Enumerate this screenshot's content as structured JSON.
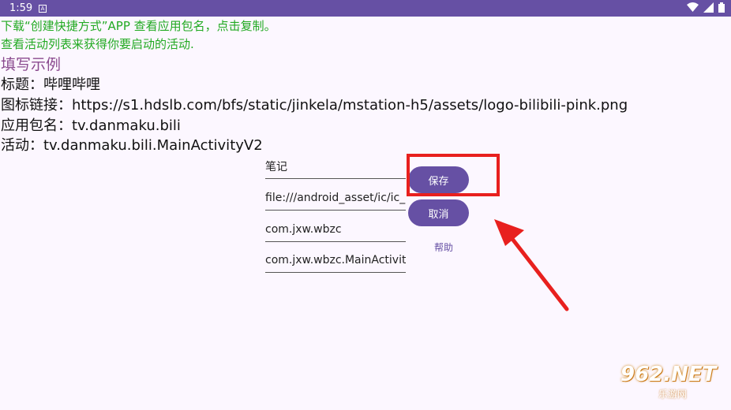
{
  "status_bar": {
    "time": "1:59",
    "notification_icon": "a-box-icon"
  },
  "instructions": {
    "line1": "下载“创建快捷方式”APP 查看应用包名，点击复制。",
    "line2": "查看活动列表来获得你要启动的活动."
  },
  "example": {
    "heading": "填写示例",
    "title_line": "标题：哔哩哔哩",
    "icon_line": "图标链接：https://s1.hdslb.com/bfs/static/jinkela/mstation-h5/assets/logo-bilibili-pink.png",
    "package_line": "应用包名：tv.danmaku.bili",
    "activity_line": "活动：tv.danmaku.bili.MainActivityV2"
  },
  "form": {
    "title_value": "笔记",
    "icon_value": "file:///android_asset/ic/ic_",
    "package_value": "com.jxw.wbzc",
    "activity_value": "com.jxw.wbzc.MainActivit"
  },
  "buttons": {
    "save": "保存",
    "cancel": "取消",
    "help": "帮助"
  },
  "watermark": {
    "logo": "962.NET",
    "sub": "乐游网"
  },
  "colors": {
    "primary": "#6650a4",
    "instruction_text": "#22aa22",
    "highlight": "#e8201e"
  }
}
